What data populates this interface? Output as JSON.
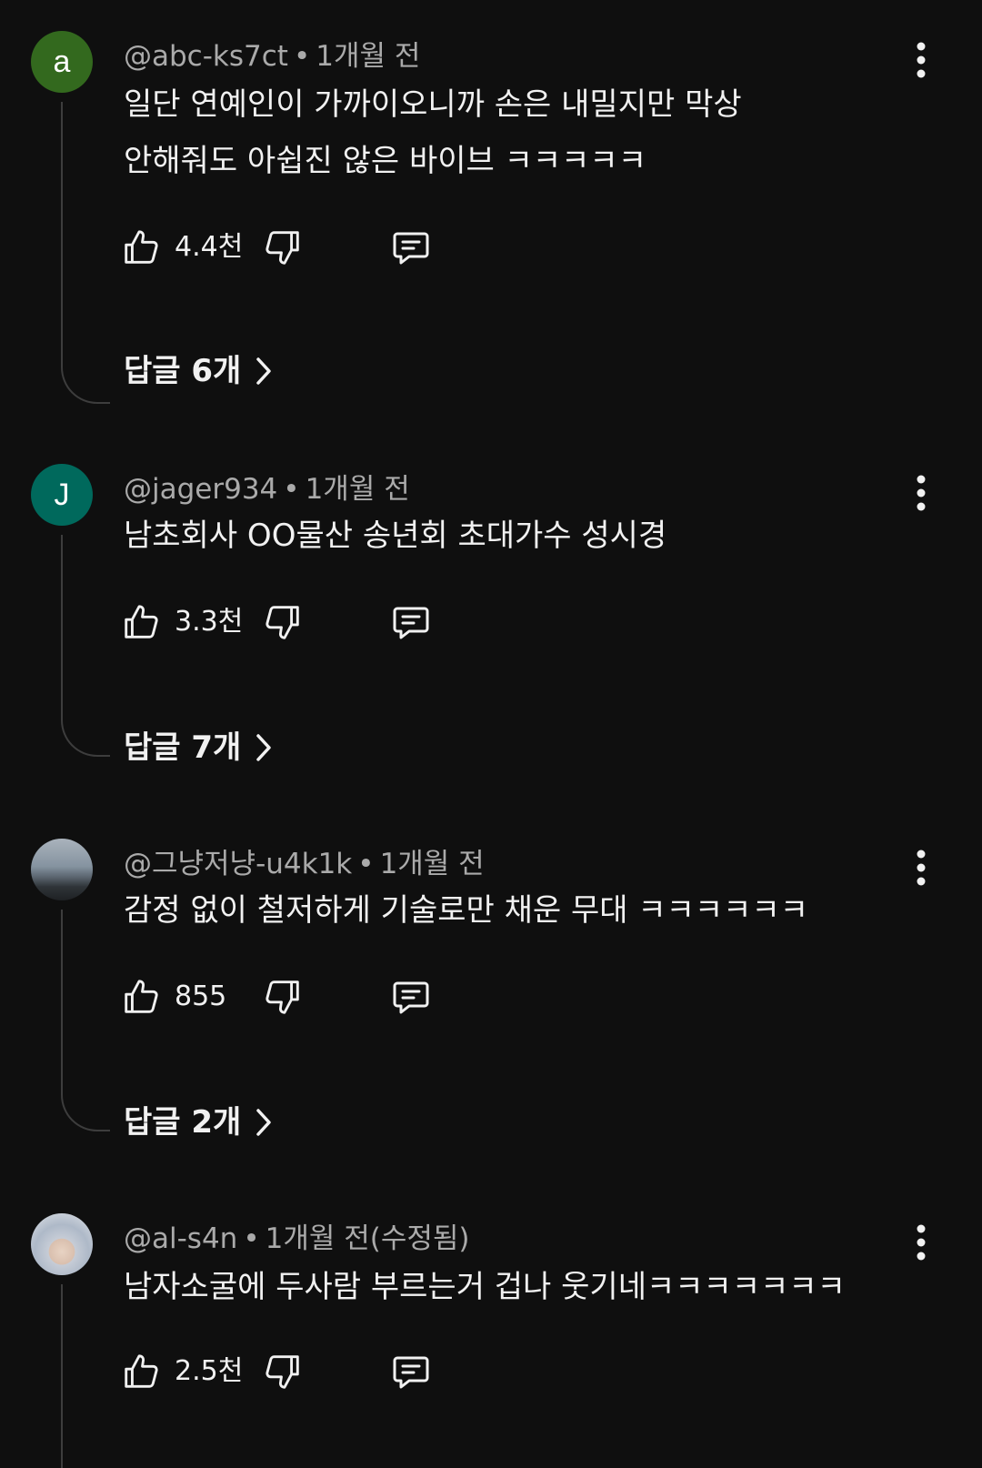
{
  "comments": [
    {
      "avatar_letter": "a",
      "avatar_color": "#33691e",
      "author": "@abc-ks7ct",
      "time": "1개월 전",
      "text_lines": [
        "일단 연예인이 가까이오니까 손은 내밀지만 막상",
        "안해줘도 아쉽진 않은 바이브 ㅋㅋㅋㅋㅋ"
      ],
      "likes": "4.4천",
      "replies_label": "답글 6개"
    },
    {
      "avatar_letter": "J",
      "avatar_color": "#00695c",
      "author": "@jager934",
      "time": "1개월 전",
      "text_lines": [
        "남초회사 OO물산 송년회 초대가수 성시경"
      ],
      "likes": "3.3천",
      "replies_label": "답글 7개"
    },
    {
      "avatar_letter": "",
      "avatar_color": "#6d7d8c",
      "author": "@그냥저냥-u4k1k",
      "time": "1개월 전",
      "text_lines": [
        "감정 없이 철저하게 기술로만 채운 무대 ㅋㅋㅋㅋㅋㅋ"
      ],
      "likes": "855",
      "replies_label": "답글 2개"
    },
    {
      "avatar_letter": "",
      "avatar_color": "#c9ccd2",
      "author": "@al-s4n",
      "time": "1개월 전(수정됨)",
      "text_lines": [
        "남자소굴에 두사람 부르는거 겁나 웃기네ㅋㅋㅋㅋㅋㅋㅋ"
      ],
      "likes": "2.5천",
      "replies_label": ""
    }
  ],
  "icons": {
    "like": "thumbs-up-icon",
    "dislike": "thumbs-down-icon",
    "reply": "reply-icon",
    "more": "more-vert-icon",
    "chevron": "chevron-right-icon"
  },
  "colors": {
    "background": "#0f0f0f",
    "primary_text": "#f1f1f1",
    "secondary_text": "#aaaaaa",
    "thread_line": "#3d3d3d"
  }
}
